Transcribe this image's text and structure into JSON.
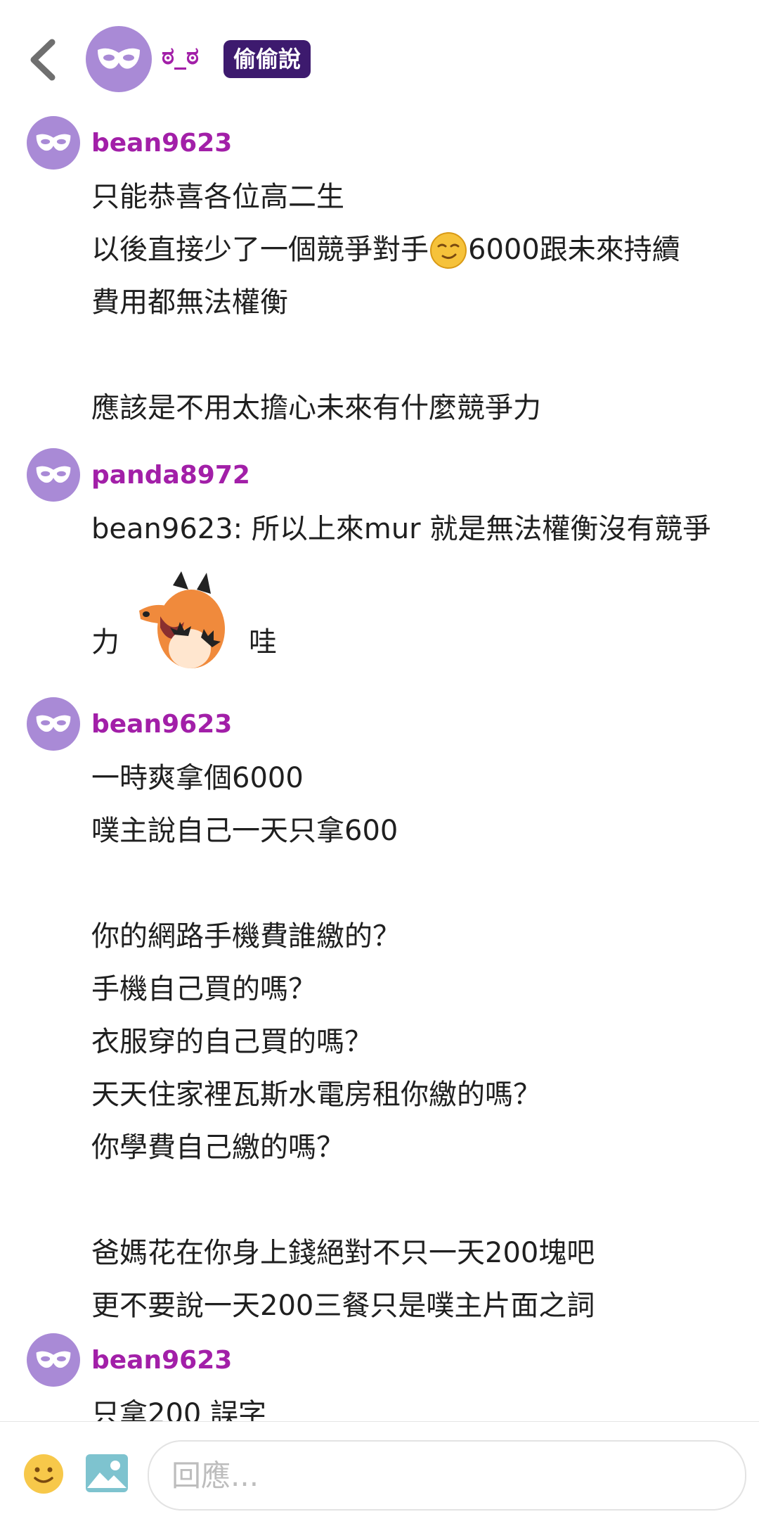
{
  "header": {
    "poster_name": "ಠ_ಠ",
    "badge": "偷偷說"
  },
  "responses": [
    {
      "user": "bean9623",
      "lines": [
        "只能恭喜各位高二生",
        "以後直接少了一個競爭對手",
        "6000跟未來持續",
        "費用都無法權衡",
        "",
        "應該是不用太擔心未來有什麼競爭力"
      ]
    },
    {
      "user": "panda8972",
      "lines": [
        "bean9623: 所以上來mur 就是無法權衡沒有競爭",
        "力",
        "哇"
      ]
    },
    {
      "user": "bean9623",
      "lines": [
        "一時爽拿個6000",
        "噗主說自己一天只拿600",
        "",
        "你的網路手機費誰繳的？",
        "手機自己買的嗎？",
        "衣服穿的自己買的嗎？",
        "天天住家裡瓦斯水電房租你繳的嗎？",
        "你學費自己繳的嗎？",
        "",
        "爸媽花在你身上錢絕對不只一天200塊吧",
        "更不要說一天200三餐只是噗主片面之詞"
      ]
    },
    {
      "user": "bean9623",
      "lines": [
        "只拿200 誤字"
      ]
    }
  ],
  "footer": {
    "reply_placeholder": "回應..."
  }
}
